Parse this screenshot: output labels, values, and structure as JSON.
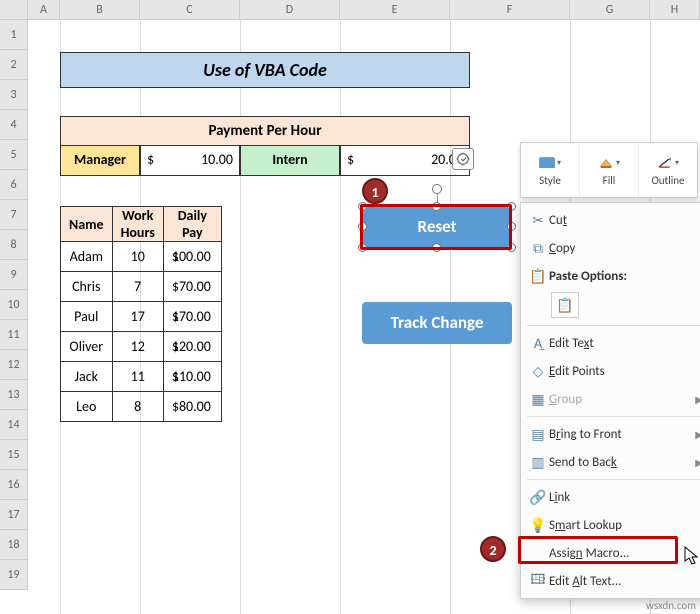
{
  "columns": [
    "",
    "A",
    "B",
    "C",
    "D",
    "E",
    "F",
    "G",
    "H"
  ],
  "rows": [
    "1",
    "2",
    "3",
    "4",
    "5",
    "6",
    "7",
    "8",
    "9",
    "10",
    "11",
    "12",
    "13",
    "14",
    "15",
    "16",
    "17",
    "18",
    "19"
  ],
  "title": "Use of  VBA Code",
  "pph": {
    "header": "Payment Per Hour",
    "manager_label": "Manager",
    "manager_currency": "$",
    "manager_value": "10.00",
    "intern_label": "Intern",
    "intern_currency": "$",
    "intern_value": "20.00"
  },
  "table": {
    "headers": {
      "name": "Name",
      "work_hours": "Work Hours",
      "daily_pay": "Daily Pay"
    },
    "rows": [
      {
        "name": "Adam",
        "hours": "10",
        "cur": "$",
        "pay": "100.00"
      },
      {
        "name": "Chris",
        "hours": "7",
        "cur": "$",
        "pay": "70.00"
      },
      {
        "name": "Paul",
        "hours": "17",
        "cur": "$",
        "pay": "170.00"
      },
      {
        "name": "Oliver",
        "hours": "12",
        "cur": "$",
        "pay": "120.00"
      },
      {
        "name": "Jack",
        "hours": "11",
        "cur": "$",
        "pay": "110.00"
      },
      {
        "name": "Leo",
        "hours": "8",
        "cur": "$",
        "pay": "80.00"
      }
    ]
  },
  "buttons": {
    "reset": "Reset",
    "track": "Track Change"
  },
  "badges": {
    "one": "1",
    "two": "2"
  },
  "mini_toolbar": {
    "style": "Style",
    "fill": "Fill",
    "outline": "Outline"
  },
  "context_menu": {
    "cut": "Cut",
    "copy": "Copy",
    "paste_label": "Paste Options:",
    "edit_text": "Edit Text",
    "edit_points": "Edit Points",
    "group": "Group",
    "bring_front": "Bring to Front",
    "send_back": "Send to Back",
    "link": "Link",
    "smart_lookup": "Smart Lookup",
    "assign_macro": "Assign Macro...",
    "alt_text": "Edit Alt Text..."
  },
  "watermark": "wsxdn.com"
}
